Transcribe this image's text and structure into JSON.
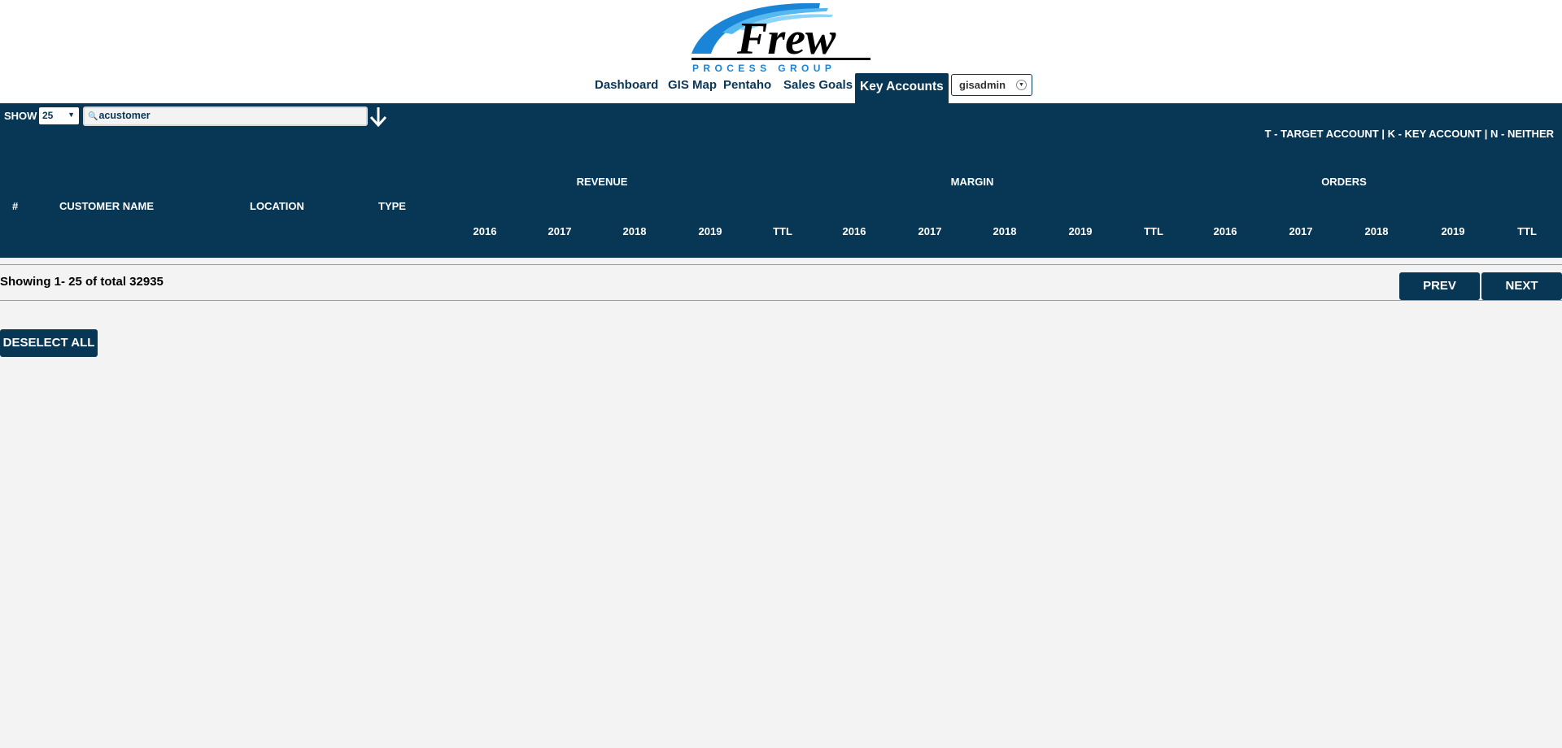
{
  "brand": {
    "name": "Frew",
    "tagline": "PROCESS GROUP"
  },
  "nav": {
    "items": [
      {
        "label": "Dashboard"
      },
      {
        "label": "GIS Map"
      },
      {
        "label": "Pentaho"
      },
      {
        "label": "Sales Goals"
      },
      {
        "label": "Key Accounts",
        "active": true
      }
    ],
    "user": "gisadmin"
  },
  "toolbar": {
    "show_label": "SHOW",
    "page_size": "25",
    "search_value": "acustomer"
  },
  "legend_note": "T - TARGET ACCOUNT | K - KEY ACCOUNT | N - NEITHER",
  "table": {
    "columns": {
      "num": "#",
      "customer_name": "CUSTOMER NAME",
      "location": "LOCATION",
      "type": "TYPE"
    },
    "groups": [
      "REVENUE",
      "MARGIN",
      "ORDERS"
    ],
    "years": [
      "2016",
      "2017",
      "2018",
      "2019",
      "TTL"
    ]
  },
  "pagination": {
    "showing_text": "Showing 1- 25 of total 32935",
    "prev_label": "PREV",
    "next_label": "NEXT"
  },
  "actions": {
    "deselect_all_label": "DESELECT ALL"
  },
  "colors": {
    "brand_navy": "#083755",
    "logo_blue": "#1a84d6",
    "background": "#f3f3f3"
  }
}
